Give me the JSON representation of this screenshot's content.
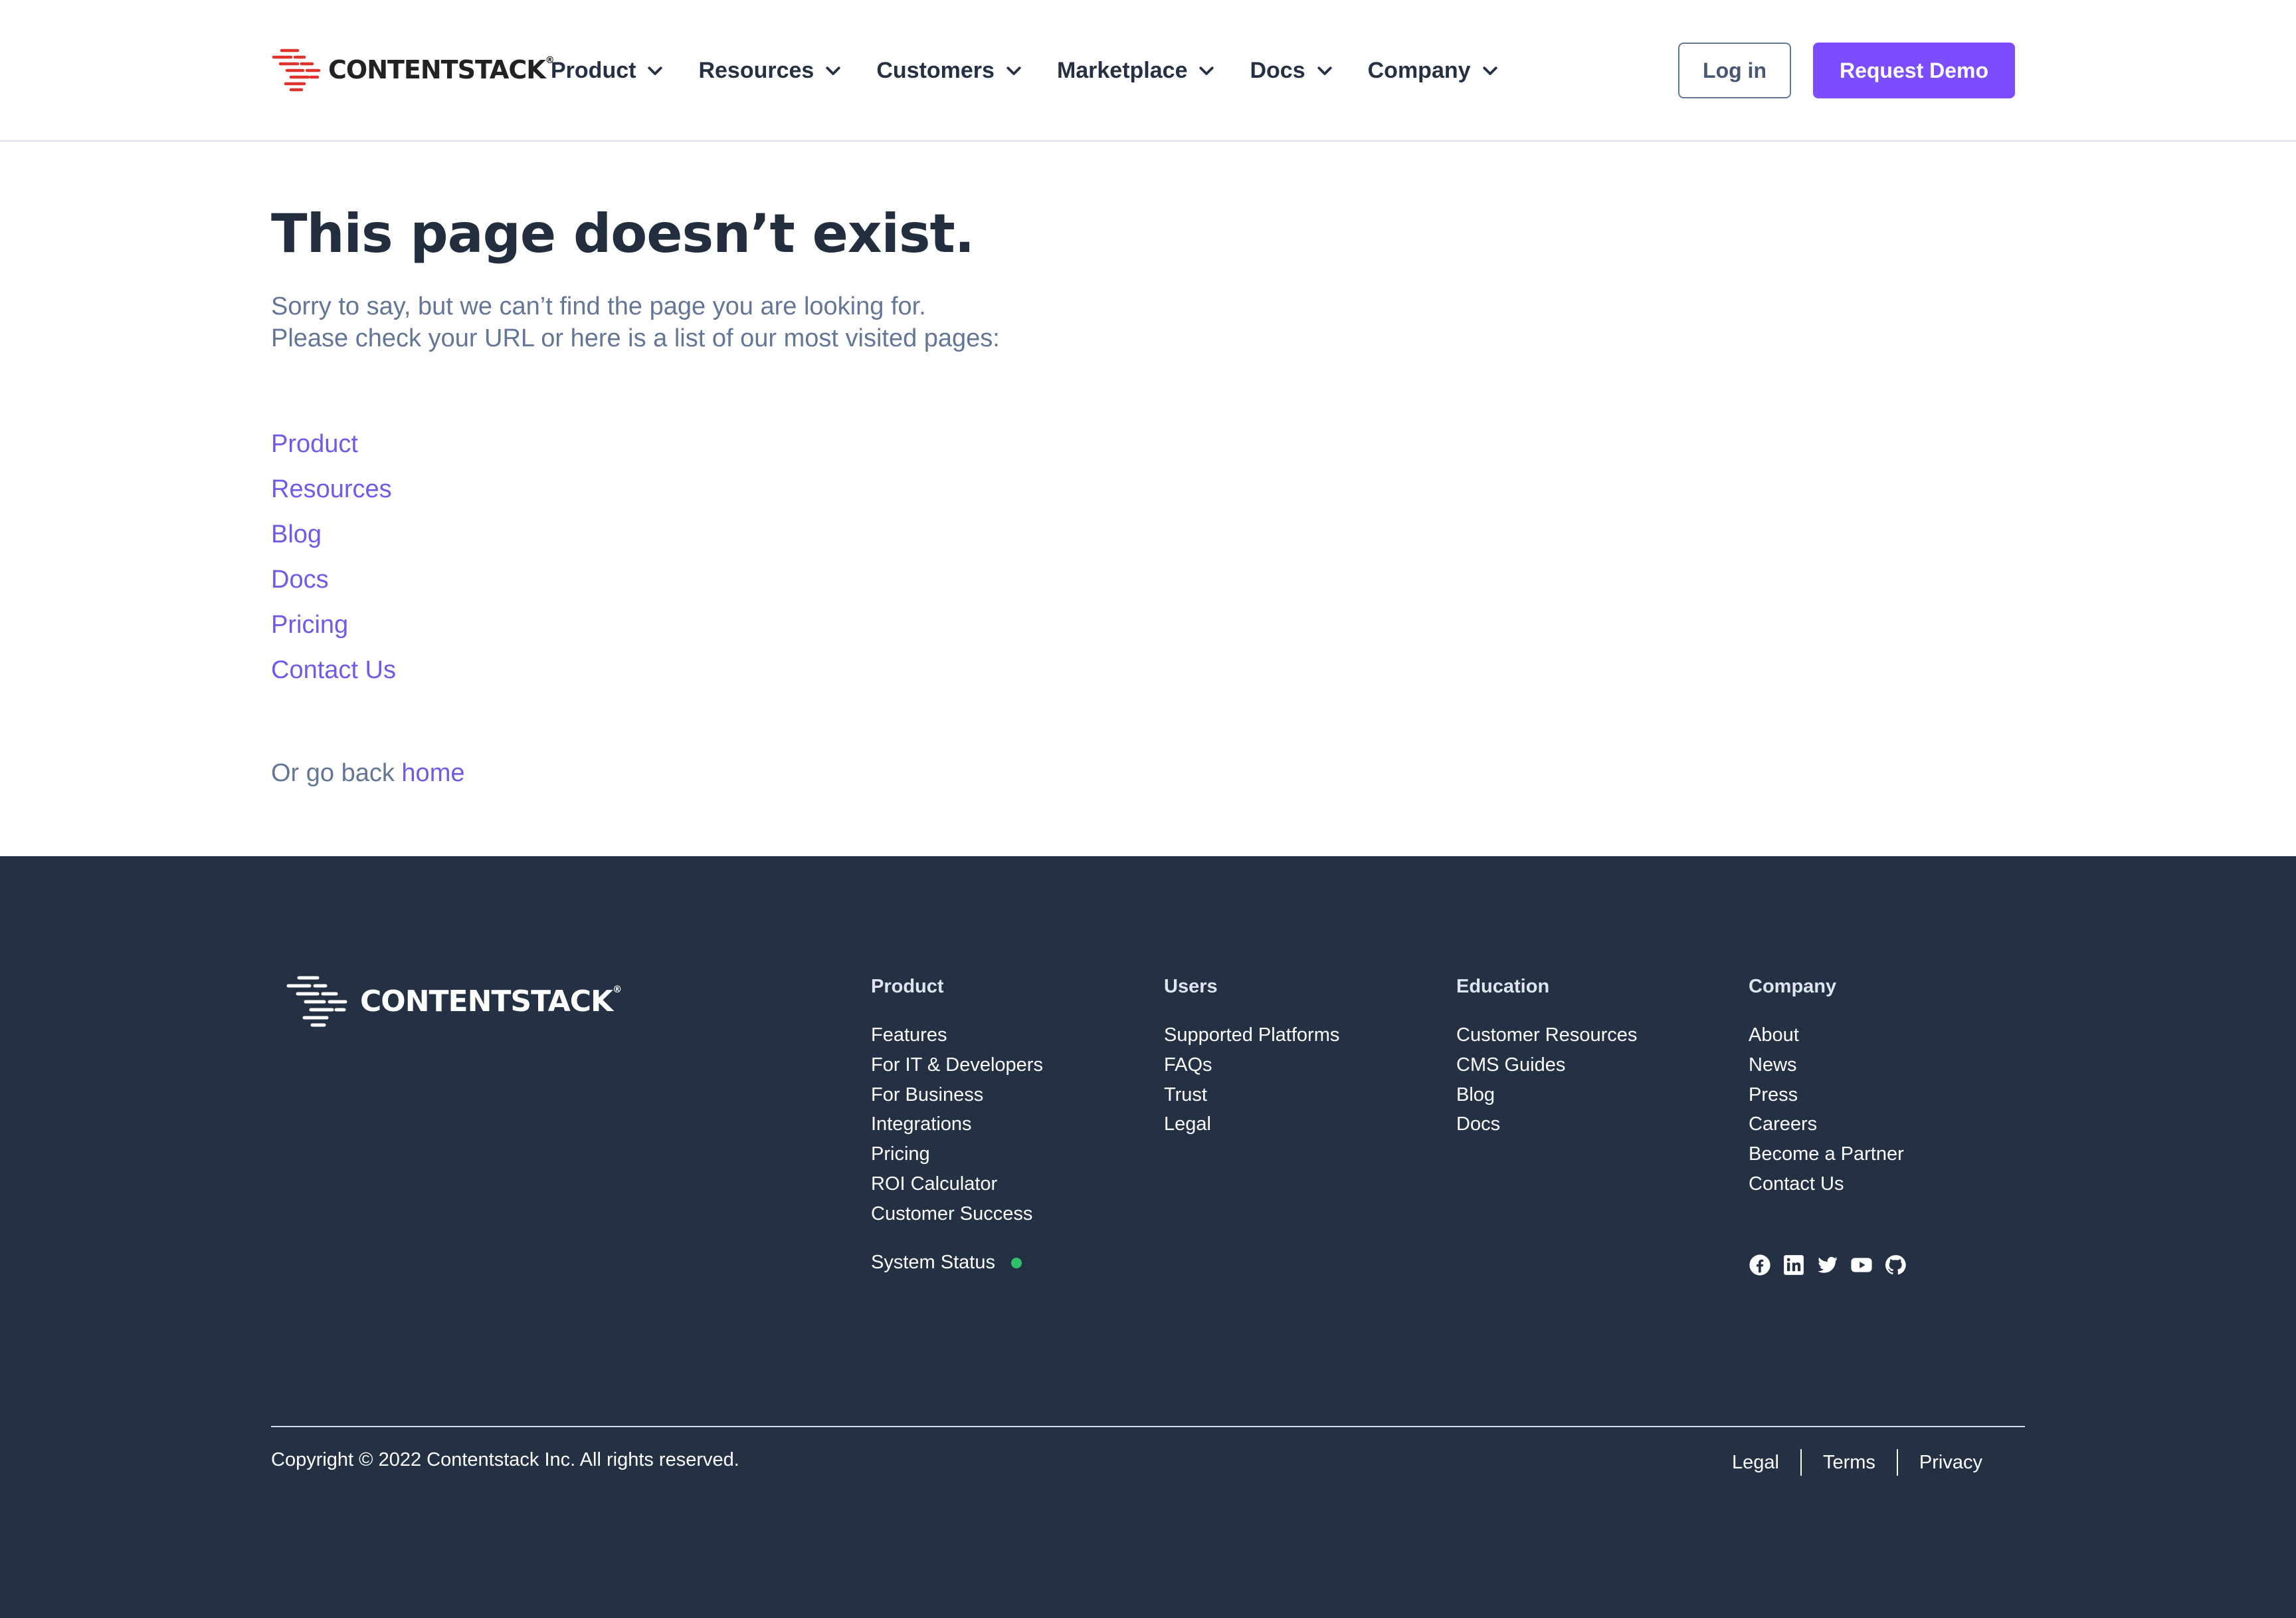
{
  "brand": {
    "name": "CONTENTSTACK",
    "trademark": "®",
    "logo_color": "#e0332d",
    "accent_color": "#7c4dff"
  },
  "header": {
    "nav": [
      {
        "label": "Product"
      },
      {
        "label": "Resources"
      },
      {
        "label": "Customers"
      },
      {
        "label": "Marketplace"
      },
      {
        "label": "Docs"
      },
      {
        "label": "Company"
      }
    ],
    "login_label": "Log in",
    "demo_label": "Request Demo"
  },
  "main": {
    "title": "This page doesn’t exist.",
    "intro_line1": "Sorry to say, but we can’t find the page you are looking for.",
    "intro_line2": "Please check your URL or here is a list of our most visited pages:",
    "links": [
      "Product",
      "Resources",
      "Blog",
      "Docs",
      "Pricing",
      "Contact Us"
    ],
    "goback_prefix": "Or go back ",
    "goback_link": "home"
  },
  "footer": {
    "columns": [
      {
        "heading": "Product",
        "items": [
          "Features",
          "For IT & Developers",
          "For Business",
          "Integrations",
          "Pricing",
          "ROI Calculator",
          "Customer Success"
        ]
      },
      {
        "heading": "Users",
        "items": [
          "Supported Platforms",
          "FAQs",
          "Trust",
          "Legal"
        ]
      },
      {
        "heading": "Education",
        "items": [
          "Customer Resources",
          "CMS Guides",
          "Blog",
          "Docs"
        ]
      },
      {
        "heading": "Company",
        "items": [
          "About",
          "News",
          "Press",
          "Careers",
          "Become a Partner",
          "Contact Us"
        ]
      }
    ],
    "system_status": "System Status",
    "status_color": "#30c26a",
    "social_icons": [
      "facebook-icon",
      "linkedin-icon",
      "twitter-icon",
      "youtube-icon",
      "github-icon"
    ],
    "copyright": "Copyright © 2022 Contentstack Inc. All rights reserved.",
    "legal_links": [
      "Legal",
      "Terms",
      "Privacy"
    ]
  }
}
